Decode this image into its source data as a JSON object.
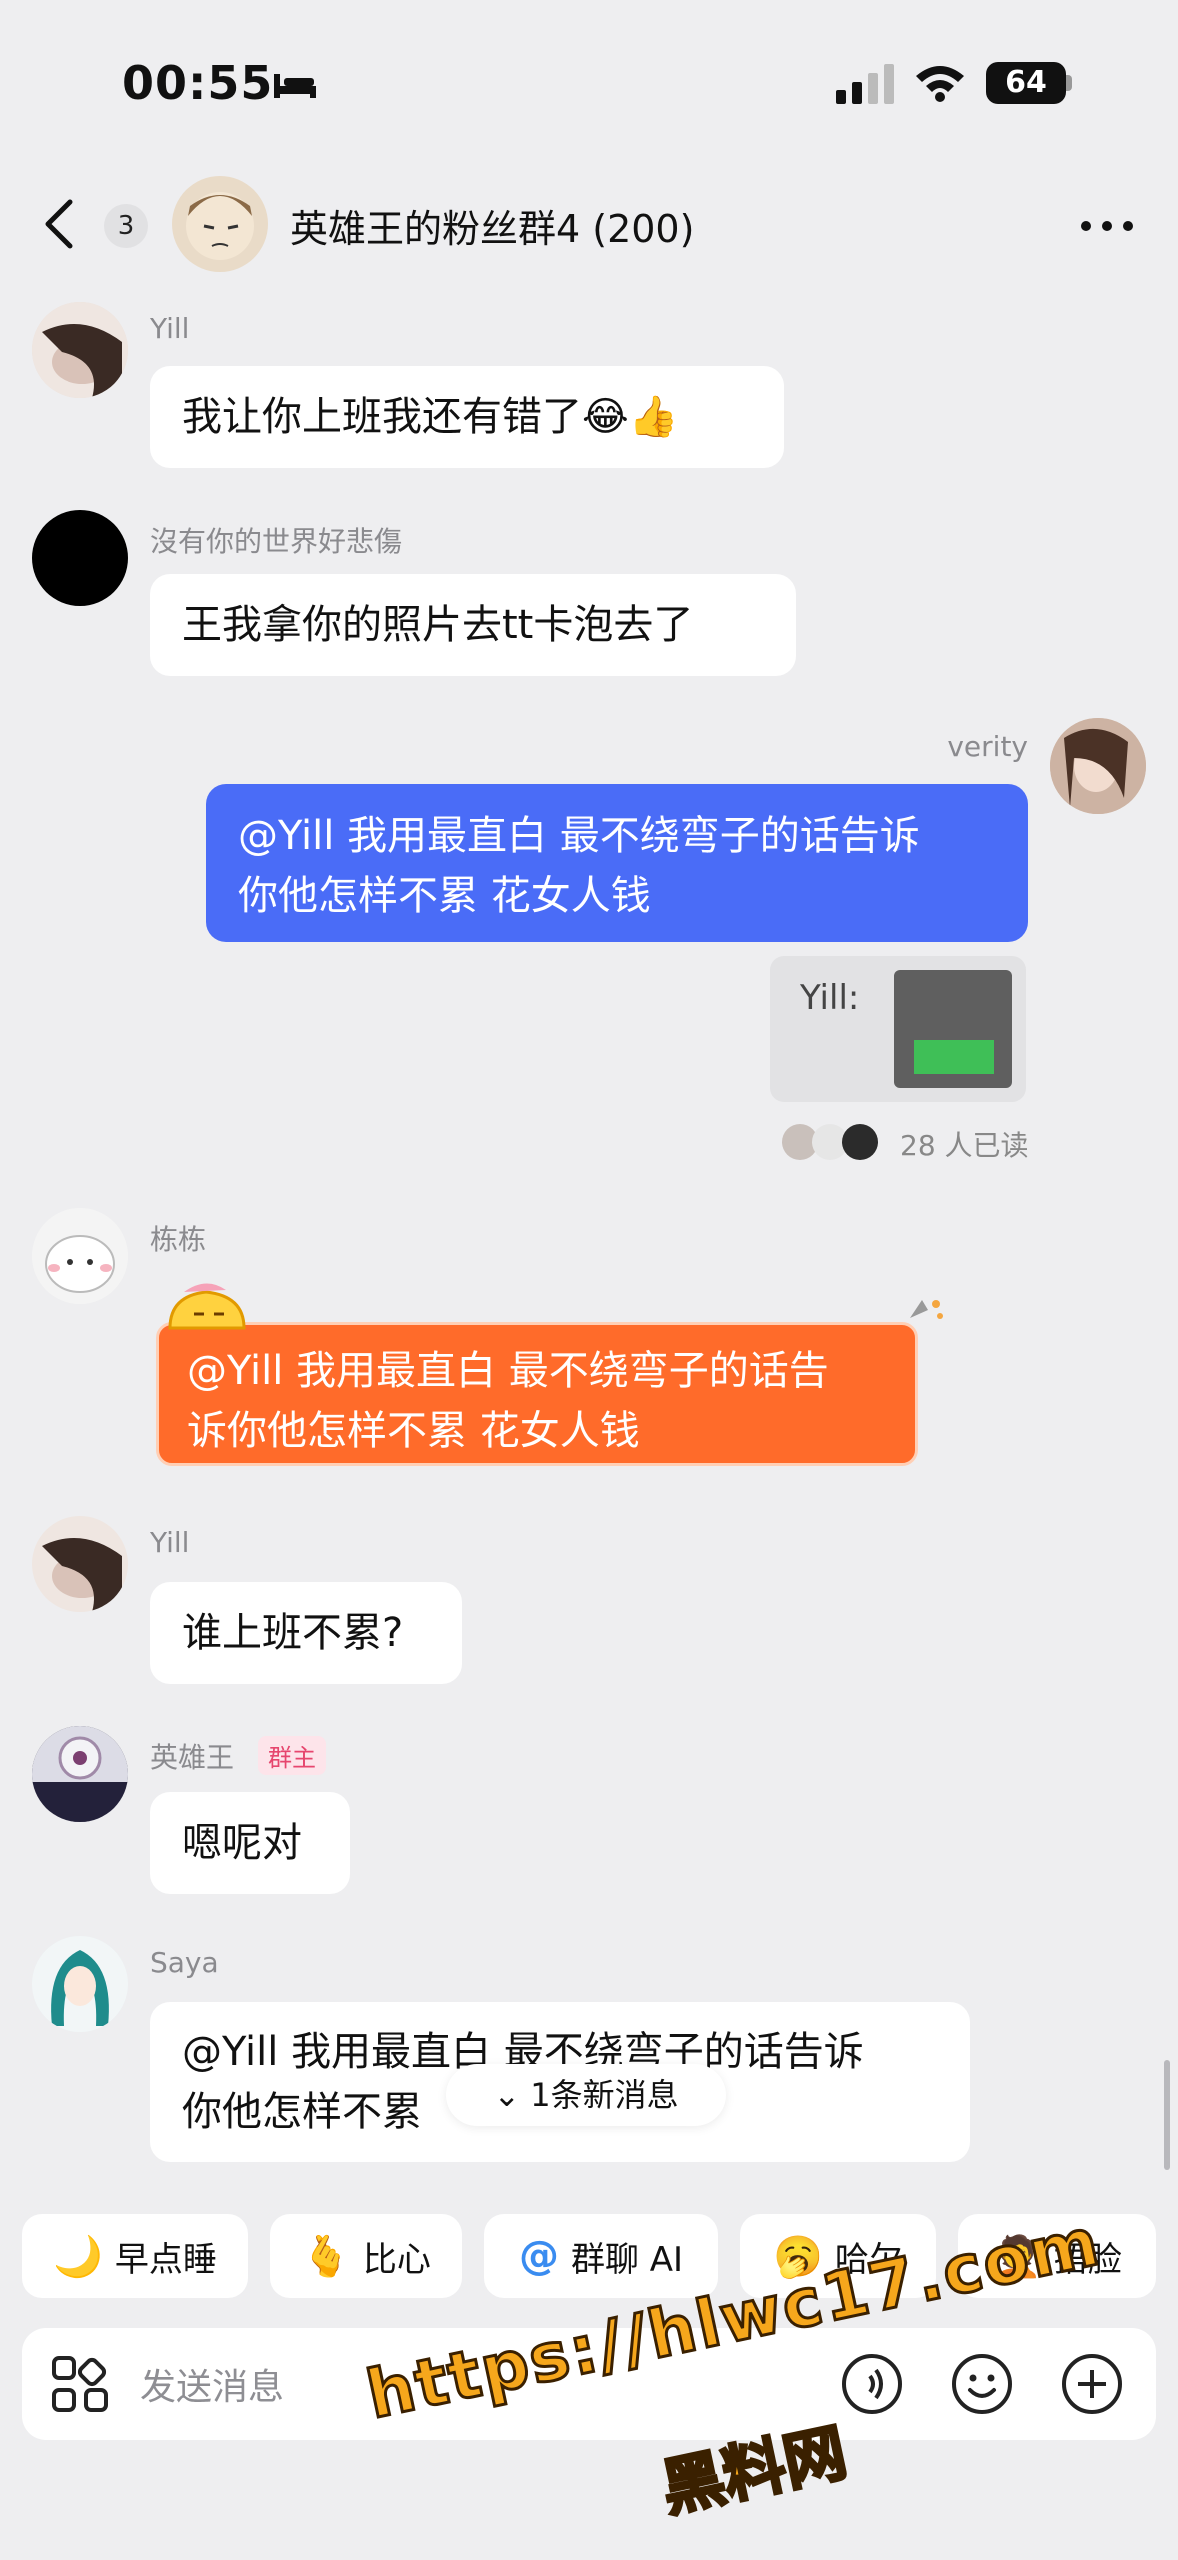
{
  "status_bar": {
    "time": "00:55",
    "battery": "64"
  },
  "header": {
    "unread_count": "3",
    "title": "英雄王的粉丝群4 (200)"
  },
  "messages": [
    {
      "sender": "Yill",
      "text": "我让你上班我还有错了😂👍"
    },
    {
      "sender": "沒有你的世界好悲傷",
      "text": "王我拿你的照片去tt卡泡去了"
    },
    {
      "sender": "verity",
      "line1": "@Yill 我用最直白 最不绕弯子的话告诉",
      "line2": "你他怎样不累 花女人钱",
      "image_label": "Yill:"
    },
    {
      "sender": "栋栋",
      "line1": "@Yill 我用最直白 最不绕弯子的话告",
      "line2": "诉你他怎样不累 花女人钱"
    },
    {
      "sender": "Yill",
      "text": "谁上班不累?"
    },
    {
      "sender": "英雄王",
      "badge": "群主",
      "text": "嗯呢对"
    },
    {
      "sender": "Saya",
      "line1": "@Yill 我用最直白 最不绕弯子的话告诉",
      "line2": "你他怎样不累"
    }
  ],
  "read_receipt": "28 人已读",
  "new_messages": "1条新消息",
  "quick_replies": [
    {
      "emoji": "🌙",
      "label": "早点睡"
    },
    {
      "emoji": "🫰",
      "label": "比心"
    },
    {
      "emoji": "@",
      "label": "群聊 AI"
    },
    {
      "emoji": "🥱",
      "label": "哈欠"
    },
    {
      "emoji": "🤦",
      "label": "捂脸"
    }
  ],
  "composer": {
    "placeholder": "发送消息"
  },
  "watermark": {
    "url": "https://hlwc17.com",
    "name": "黑料网"
  },
  "colors": {
    "self_bubble": "#4a6cf7",
    "highlight_bubble": "#ff6b2a",
    "background": "#eeeef0"
  }
}
